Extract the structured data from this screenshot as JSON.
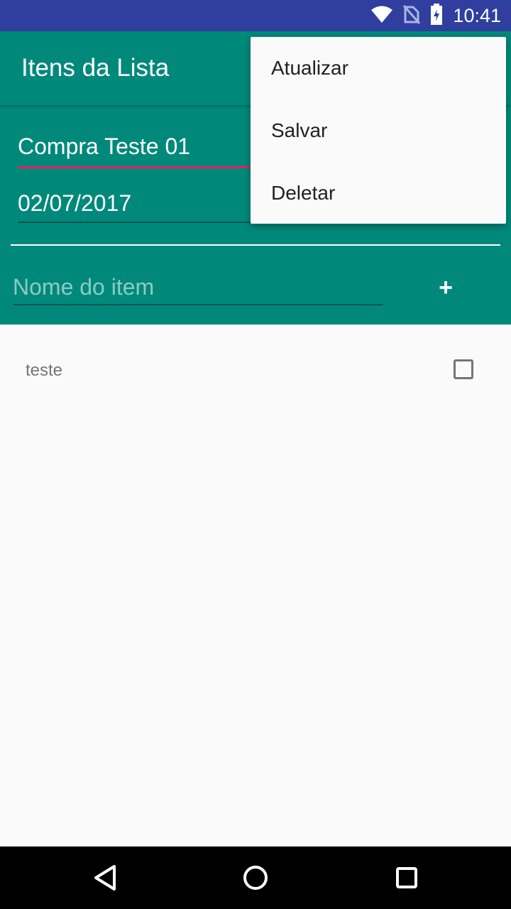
{
  "status_bar": {
    "time": "10:41",
    "icons": [
      "wifi-icon",
      "no-sim-icon",
      "battery-charging-icon"
    ],
    "color": "#303f9f"
  },
  "app_bar": {
    "title": "Itens da Lista",
    "color": "#00897b"
  },
  "form": {
    "list_name_value": "Compra Teste 01",
    "date_value": "02/07/2017",
    "item_name_placeholder": "Nome do item",
    "add_button_label": "+",
    "accent_color": "#e91e63"
  },
  "items": [
    {
      "label": "teste",
      "checked": false
    }
  ],
  "overflow_menu": {
    "items": [
      "Atualizar",
      "Salvar",
      "Deletar"
    ]
  },
  "nav_bar": {
    "icons": [
      "back-icon",
      "home-icon",
      "recents-icon"
    ]
  }
}
